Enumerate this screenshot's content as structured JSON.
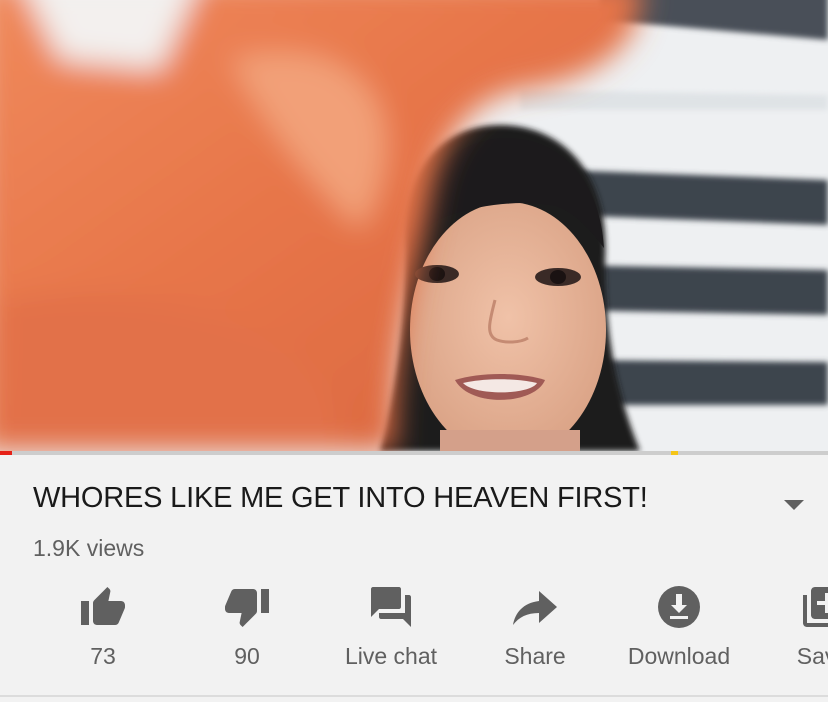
{
  "video": {
    "title": "WHORES LIKE ME GET INTO HEAVEN FIRST!",
    "views": "1.9K views",
    "progress_fraction": 0.015
  },
  "actions": [
    {
      "name": "like",
      "icon": "thumbs-up-icon",
      "label": "73"
    },
    {
      "name": "dislike",
      "icon": "thumbs-down-icon",
      "label": "90"
    },
    {
      "name": "live-chat",
      "icon": "chat-bubbles-icon",
      "label": "Live chat"
    },
    {
      "name": "share",
      "icon": "share-arrow-icon",
      "label": "Share"
    },
    {
      "name": "download",
      "icon": "download-icon",
      "label": "Download"
    },
    {
      "name": "save",
      "icon": "playlist-add-icon",
      "label": "Save"
    }
  ],
  "colors": {
    "icon": "#606060",
    "progress": "#e62117",
    "background": "#f2f2f2"
  }
}
